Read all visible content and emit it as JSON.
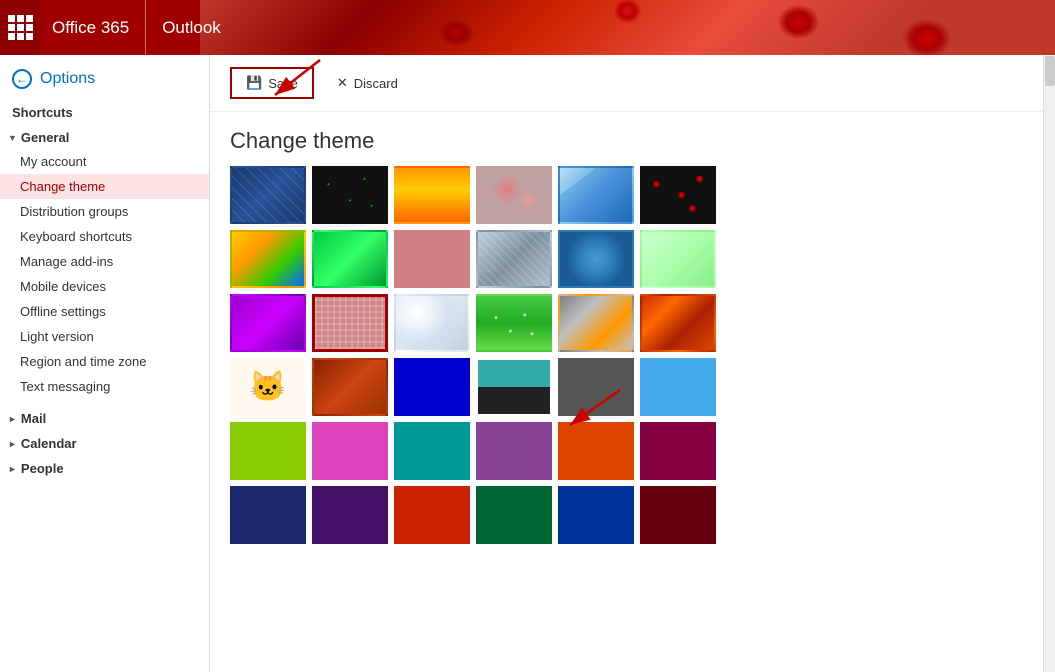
{
  "topbar": {
    "office365_label": "Office 365",
    "outlook_label": "Outlook"
  },
  "sidebar": {
    "options_label": "Options",
    "shortcuts_label": "Shortcuts",
    "general_label": "General",
    "items": [
      {
        "id": "my-account",
        "label": "My account"
      },
      {
        "id": "change-theme",
        "label": "Change theme",
        "active": true
      },
      {
        "id": "distribution-groups",
        "label": "Distribution groups"
      },
      {
        "id": "keyboard-shortcuts",
        "label": "Keyboard shortcuts"
      },
      {
        "id": "manage-add-ins",
        "label": "Manage add-ins"
      },
      {
        "id": "mobile-devices",
        "label": "Mobile devices"
      },
      {
        "id": "offline-settings",
        "label": "Offline settings"
      },
      {
        "id": "light-version",
        "label": "Light version"
      },
      {
        "id": "region-and-time-zone",
        "label": "Region and time zone"
      },
      {
        "id": "text-messaging",
        "label": "Text messaging"
      }
    ],
    "mail_label": "Mail",
    "calendar_label": "Calendar",
    "people_label": "People"
  },
  "toolbar": {
    "save_label": "Save",
    "discard_label": "Discard"
  },
  "content": {
    "title": "Change theme"
  }
}
